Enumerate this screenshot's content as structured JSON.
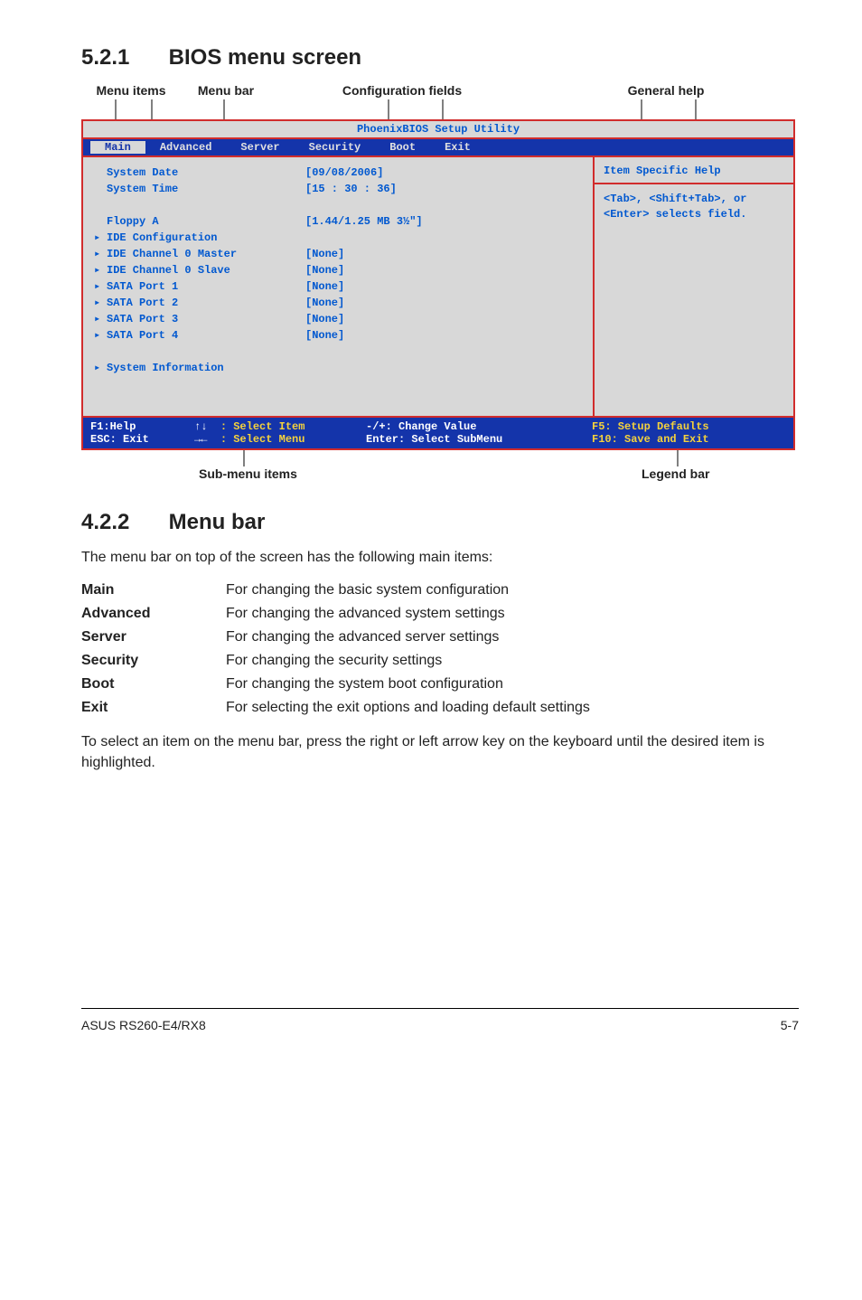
{
  "section521": {
    "num": "5.2.1",
    "title": "BIOS menu screen"
  },
  "diagram_labels": {
    "menu_items": "Menu items",
    "menu_bar": "Menu bar",
    "config_fields": "Configuration fields",
    "general_help": "General help",
    "submenu_items": "Sub-menu items",
    "legend_bar": "Legend bar"
  },
  "bios": {
    "title": "PhoenixBIOS Setup Utility",
    "menubar": [
      "Main",
      "Advanced",
      "Server",
      "Security",
      "Boot",
      "Exit"
    ],
    "selected_tab": "Main",
    "left": {
      "System Date": "[09/08/2006]",
      "System Time": "[15 : 30 : 36]",
      "Floppy A": "[1.44/1.25 MB 3½\"]",
      "IDE Configuration": "",
      "IDE Channel 0 Master": "[None]",
      "IDE Channel 0 Slave": "[None]",
      "SATA Port 1": "[None]",
      "SATA Port 2": "[None]",
      "SATA Port 3": "[None]",
      "SATA Port 4": "[None]",
      "System Information": ""
    },
    "help_title": "Item Specific Help",
    "help_body": "<Tab>, <Shift+Tab>, or <Enter> selects field.",
    "legend": {
      "f1": "F1:Help",
      "esc": "ESC: Exit",
      "sel_item": ": Select Item",
      "sel_menu": ": Select Menu",
      "change": "-/+: Change Value",
      "enter": "Enter: Select SubMenu",
      "f5": "F5: Setup Defaults",
      "f10": "F10: Save and Exit"
    }
  },
  "section422": {
    "num": "4.2.2",
    "title": "Menu bar"
  },
  "menubar_intro": "The menu bar on top of the screen has the following main items:",
  "menubar_items": {
    "Main": "For changing the basic system configuration",
    "Advanced": "For changing the advanced system settings",
    "Server": "For changing the advanced server settings",
    "Security": "For changing the security settings",
    "Boot": "For changing the system boot configuration",
    "Exit": "For selecting the exit options and loading default settings"
  },
  "menubar_outro": "To select an item on the menu bar, press the right or left arrow key on the keyboard until the desired item is highlighted.",
  "footer": {
    "left": "ASUS RS260-E4/RX8",
    "right": "5-7"
  }
}
